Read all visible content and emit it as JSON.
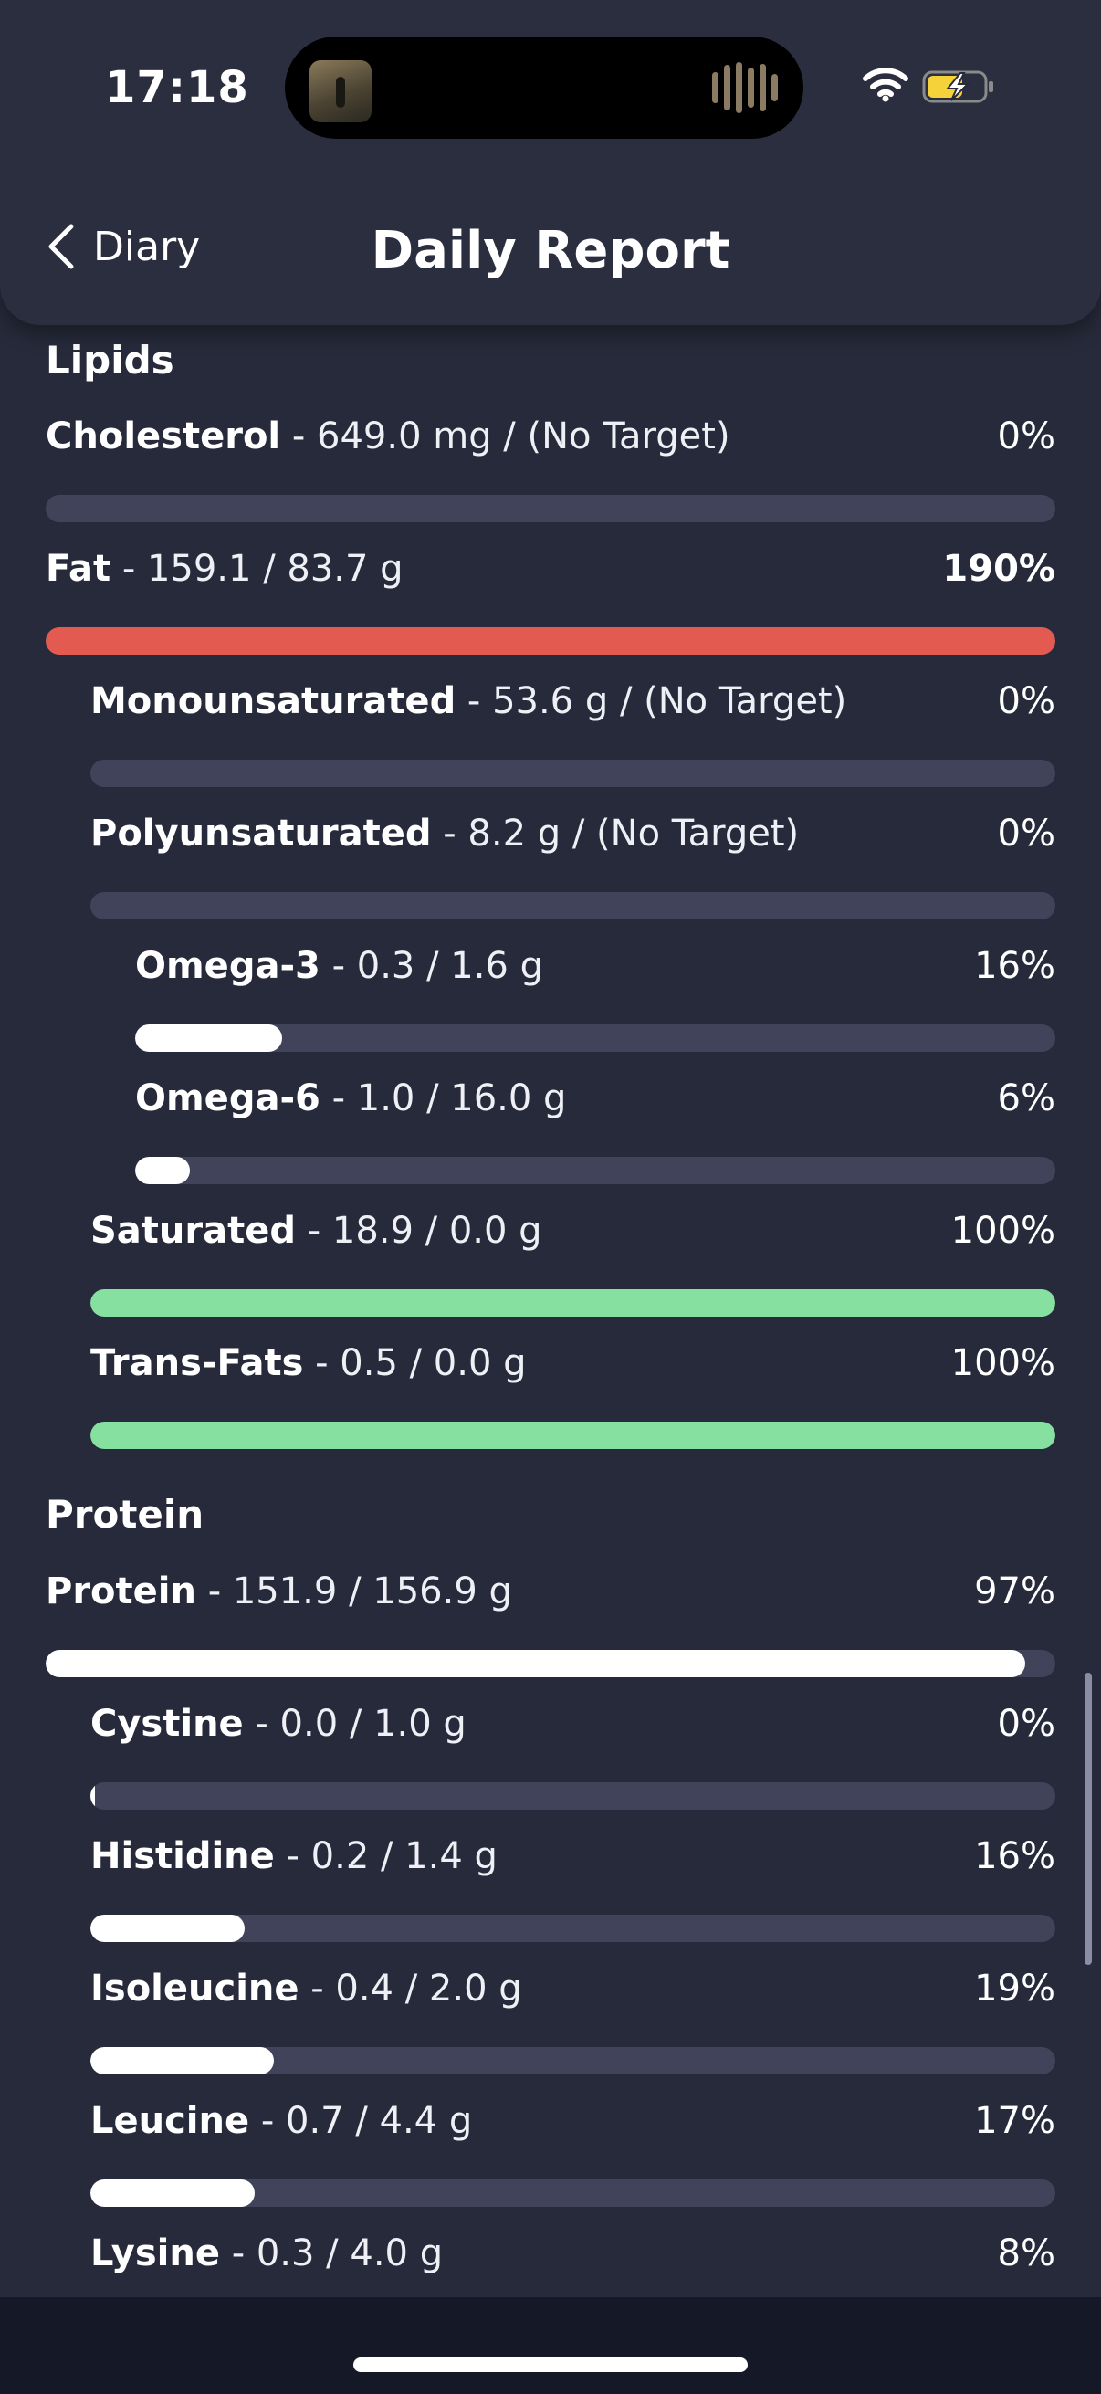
{
  "status_bar": {
    "time": "17:18"
  },
  "header": {
    "back_label": "Diary",
    "title": "Daily Report"
  },
  "colors": {
    "over": "#e25a50",
    "good": "#86e0a0",
    "progress": "#ffffff",
    "track": "#40435a"
  },
  "sections": [
    {
      "title": "Lipids",
      "items": [
        {
          "name": "Cholesterol",
          "value": "- 649.0 mg / (No Target)",
          "percent": "0%",
          "fraction": 0,
          "indent": 0,
          "status": "progress",
          "pct_bold": false
        },
        {
          "name": "Fat",
          "value": "- 159.1 / 83.7 g",
          "percent": "190%",
          "fraction": 1,
          "indent": 0,
          "status": "over",
          "pct_bold": true
        },
        {
          "name": "Monounsaturated",
          "value": "- 53.6 g / (No Target)",
          "percent": "0%",
          "fraction": 0,
          "indent": 1,
          "status": "progress",
          "pct_bold": false
        },
        {
          "name": "Polyunsaturated",
          "value": "- 8.2 g / (No Target)",
          "percent": "0%",
          "fraction": 0,
          "indent": 1,
          "status": "progress",
          "pct_bold": false
        },
        {
          "name": "Omega-3",
          "value": "- 0.3 / 1.6 g",
          "percent": "16%",
          "fraction": 0.16,
          "indent": 2,
          "status": "progress",
          "pct_bold": false
        },
        {
          "name": "Omega-6",
          "value": "- 1.0 / 16.0 g",
          "percent": "6%",
          "fraction": 0.06,
          "indent": 2,
          "status": "progress",
          "pct_bold": false
        },
        {
          "name": "Saturated",
          "value": "- 18.9 / 0.0 g",
          "percent": "100%",
          "fraction": 1,
          "indent": 1,
          "status": "good",
          "pct_bold": false
        },
        {
          "name": "Trans-Fats",
          "value": "- 0.5 / 0.0 g",
          "percent": "100%",
          "fraction": 1,
          "indent": 1,
          "status": "good",
          "pct_bold": false
        }
      ]
    },
    {
      "title": "Protein",
      "items": [
        {
          "name": "Protein",
          "value": "- 151.9 / 156.9 g",
          "percent": "97%",
          "fraction": 0.97,
          "indent": 0,
          "status": "progress",
          "pct_bold": false
        },
        {
          "name": "Cystine",
          "value": "- 0.0 / 1.0 g",
          "percent": "0%",
          "fraction": 0.005,
          "indent": 1,
          "status": "progress",
          "pct_bold": false
        },
        {
          "name": "Histidine",
          "value": "- 0.2 / 1.4 g",
          "percent": "16%",
          "fraction": 0.16,
          "indent": 1,
          "status": "progress",
          "pct_bold": false
        },
        {
          "name": "Isoleucine",
          "value": "- 0.4 / 2.0 g",
          "percent": "19%",
          "fraction": 0.19,
          "indent": 1,
          "status": "progress",
          "pct_bold": false
        },
        {
          "name": "Leucine",
          "value": "- 0.7 / 4.4 g",
          "percent": "17%",
          "fraction": 0.17,
          "indent": 1,
          "status": "progress",
          "pct_bold": false
        },
        {
          "name": "Lysine",
          "value": "- 0.3 / 4.0 g",
          "percent": "8%",
          "fraction": 0.08,
          "indent": 1,
          "status": "progress",
          "pct_bold": false
        }
      ]
    }
  ]
}
